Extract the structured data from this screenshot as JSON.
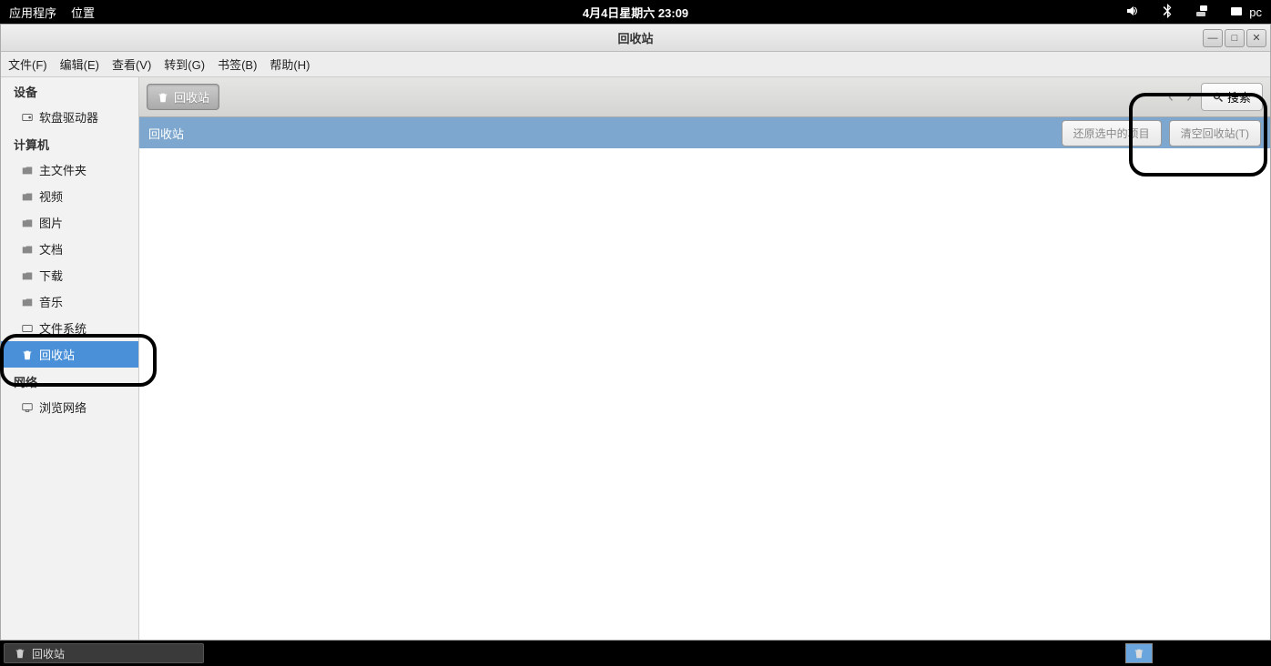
{
  "top_panel": {
    "apps": "应用程序",
    "places": "位置",
    "datetime": "4月4日星期六 23:09",
    "user": "pc"
  },
  "window": {
    "title": "回收站"
  },
  "menubar": {
    "file": "文件(F)",
    "edit": "编辑(E)",
    "view": "查看(V)",
    "go": "转到(G)",
    "bookmarks": "书签(B)",
    "help": "帮助(H)"
  },
  "sidebar": {
    "devices_header": "设备",
    "devices": [
      {
        "label": "软盘驱动器"
      }
    ],
    "computer_header": "计算机",
    "computer": [
      {
        "label": "主文件夹"
      },
      {
        "label": "视频"
      },
      {
        "label": "图片"
      },
      {
        "label": "文档"
      },
      {
        "label": "下载"
      },
      {
        "label": "音乐"
      },
      {
        "label": "文件系统"
      },
      {
        "label": "回收站",
        "selected": true
      }
    ],
    "network_header": "网络",
    "network": [
      {
        "label": "浏览网络"
      }
    ]
  },
  "toolbar": {
    "path_label": "回收站",
    "search_label": "搜索"
  },
  "info_bar": {
    "title": "回收站",
    "restore_btn": "还原选中的项目",
    "empty_btn": "清空回收站(T)"
  },
  "taskbar": {
    "task_label": "回收站"
  }
}
